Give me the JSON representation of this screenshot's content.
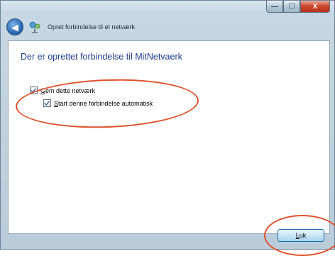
{
  "window": {
    "caption_buttons": {
      "minimize": "—",
      "maximize": "☐",
      "close": "X"
    }
  },
  "nav": {
    "title": "Opret forbindelse til et netværk",
    "back_icon": "back-arrow-icon",
    "network_icon": "network-icon"
  },
  "content": {
    "heading": "Der er oprettet forbindelse til MitNetvaerk",
    "checkboxes": [
      {
        "label_underlined": "G",
        "label_rest": "em dette netværk",
        "checked": true
      },
      {
        "label_underlined": "S",
        "label_rest": "tart denne forbindelse automatisk",
        "checked": true
      }
    ]
  },
  "footer": {
    "close_label": "Luk"
  },
  "colors": {
    "heading": "#1c3e8f",
    "annotation": "#e0502a",
    "button_border": "#1e6dae"
  }
}
